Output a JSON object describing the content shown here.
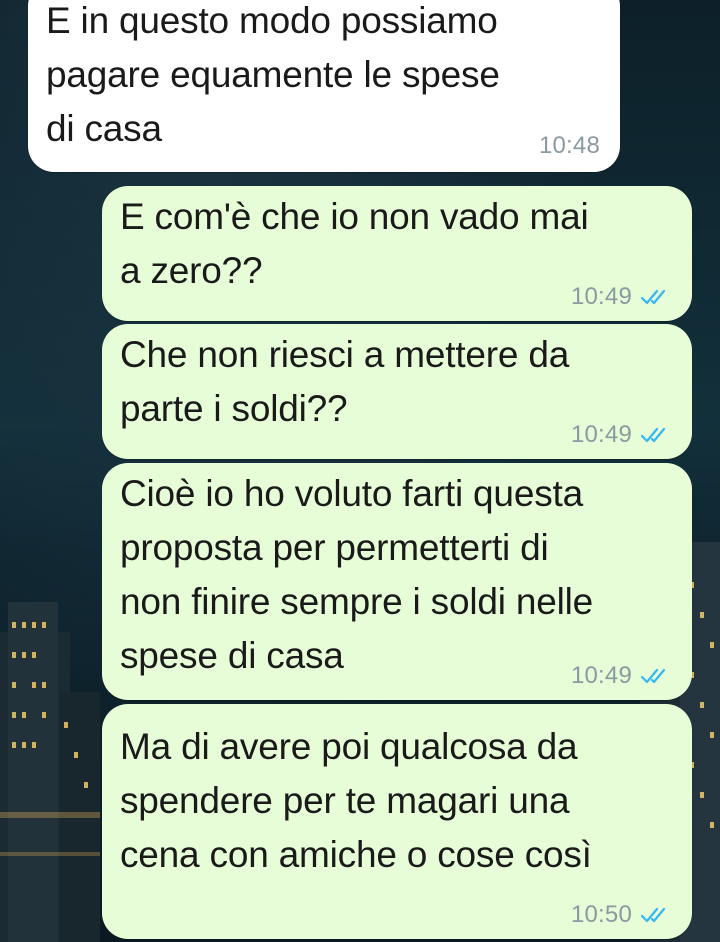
{
  "conversation": {
    "messages": [
      {
        "direction": "in",
        "text": "E in questo modo possiamo\npagare equamente le spese\ndi casa",
        "time": "10:48"
      },
      {
        "direction": "out",
        "text": "E com'è che io non vado mai\na zero??",
        "time": "10:49",
        "status": "read"
      },
      {
        "direction": "out",
        "text": "Che non riesci a mettere da\nparte i soldi??",
        "time": "10:49",
        "status": "read"
      },
      {
        "direction": "out",
        "text": "Cioè io ho voluto farti questa\nproposta per permetterti di\nnon finire sempre i soldi nelle\nspese di casa",
        "time": "10:49",
        "status": "read"
      },
      {
        "direction": "out",
        "text": "Ma di avere poi qualcosa da\nspendere per te magari una\ncena con amiche o cose così",
        "time": "10:50",
        "status": "read"
      }
    ]
  },
  "colors": {
    "incoming_bubble": "#ffffff",
    "outgoing_bubble": "#e7fdd8",
    "read_ticks": "#34b7f1",
    "timestamp": "#8a9aa1",
    "wallpaper": "#0e1f27"
  },
  "icons": {
    "read_receipt": "double-check-icon",
    "wallpaper": "city-skyline-night"
  }
}
